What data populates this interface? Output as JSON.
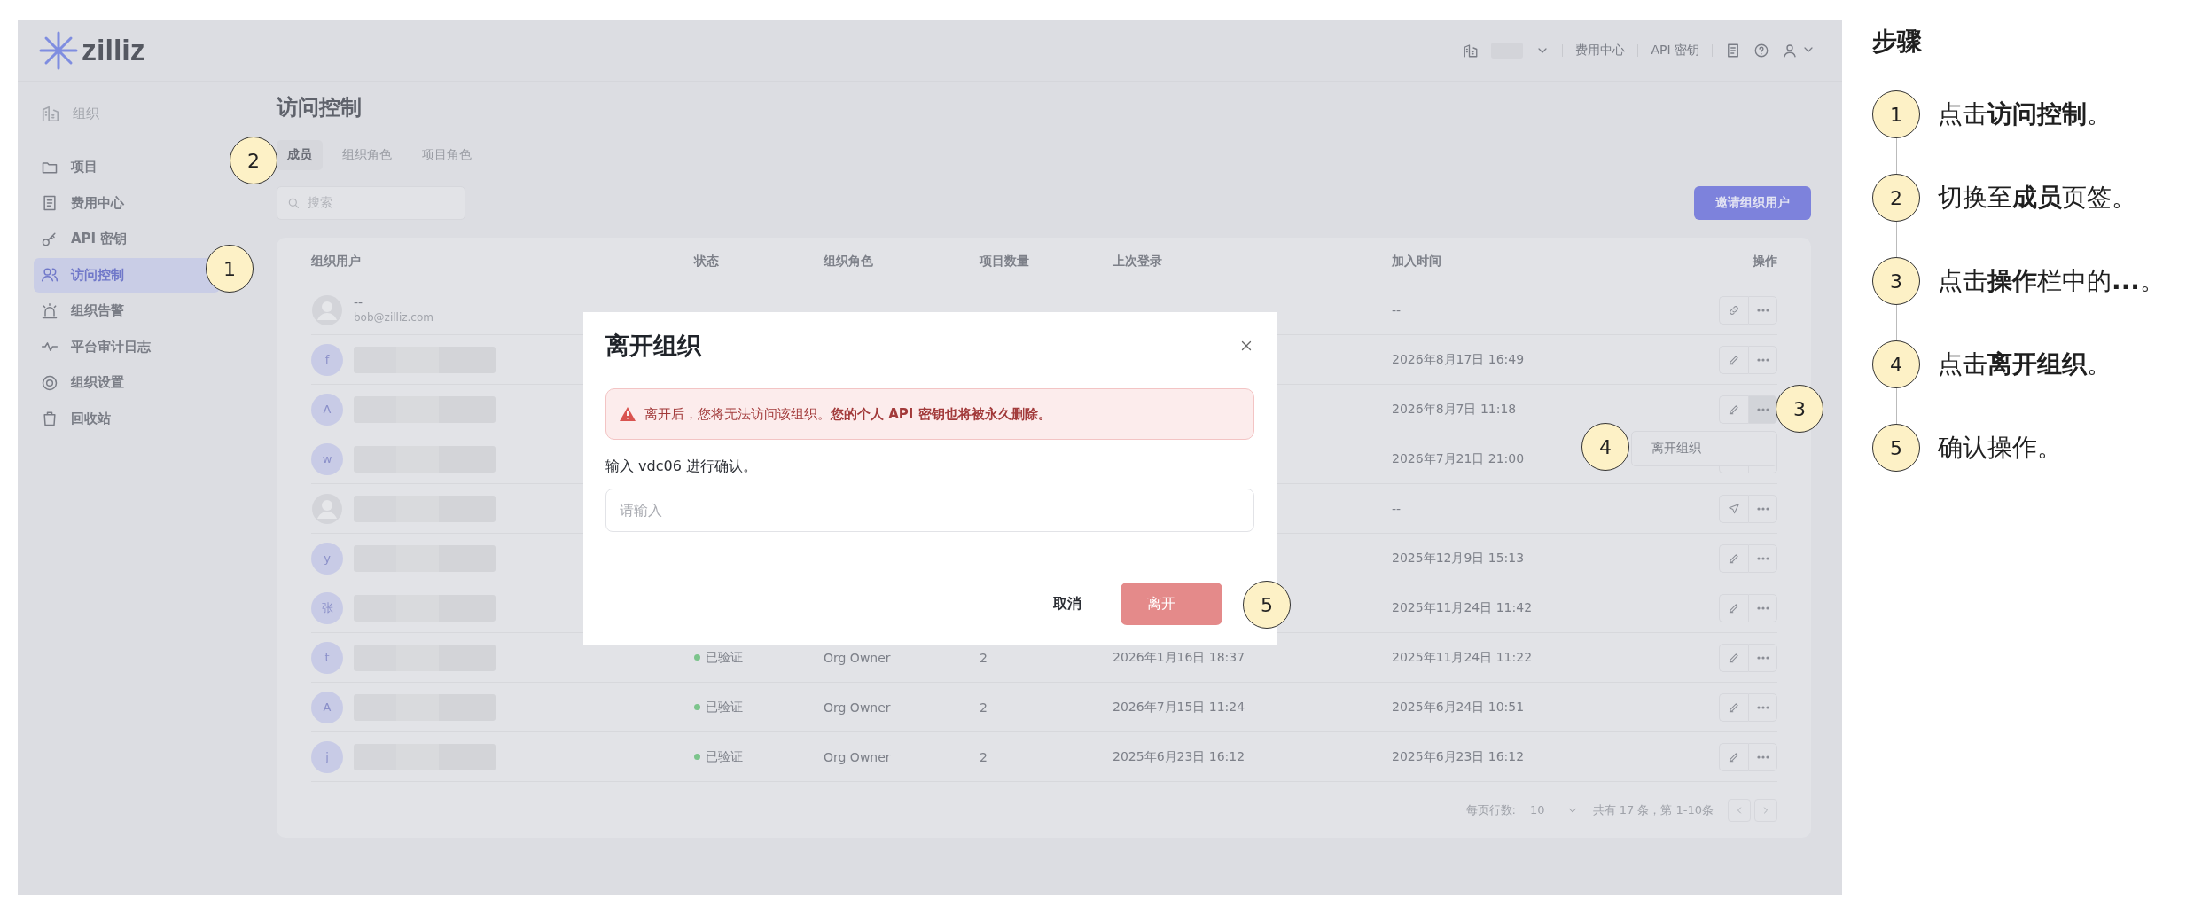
{
  "header": {
    "logo": "zilliz",
    "links": [
      "费用中心",
      "API 密钥"
    ]
  },
  "sidebar": {
    "org_label": "组织",
    "items": [
      {
        "label": "项目",
        "selected": false
      },
      {
        "label": "费用中心",
        "selected": false
      },
      {
        "label": "API 密钥",
        "selected": false
      },
      {
        "label": "访问控制",
        "selected": true
      },
      {
        "label": "组织告警",
        "selected": false
      },
      {
        "label": "平台审计日志",
        "selected": false
      },
      {
        "label": "组织设置",
        "selected": false
      },
      {
        "label": "回收站",
        "selected": false
      }
    ]
  },
  "page": {
    "title": "访问控制",
    "tabs": [
      {
        "label": "成员",
        "selected": true
      },
      {
        "label": "组织角色",
        "selected": false
      },
      {
        "label": "项目角色",
        "selected": false
      }
    ],
    "search": {
      "placeholder": "搜索"
    },
    "invite_button": "邀请组织用户"
  },
  "table": {
    "columns": [
      "组织用户",
      "状态",
      "组织角色",
      "项目数量",
      "上次登录",
      "加入时间",
      "操作"
    ],
    "rows": [
      {
        "kind": "invite",
        "name": "--",
        "email": "bob@zilliz.com",
        "joined": "--",
        "menu_open": false
      },
      {
        "kind": "member",
        "avatar": "f",
        "joined": "2026年8月17日 16:49",
        "menu_open": false
      },
      {
        "kind": "member",
        "avatar": "A",
        "joined": "2026年8月7日 11:18",
        "menu_open": true
      },
      {
        "kind": "member",
        "avatar": "w",
        "joined": "2026年7月21日 21:00",
        "menu_open": false
      },
      {
        "kind": "resend",
        "joined": "--",
        "menu_open": false
      },
      {
        "kind": "member",
        "avatar": "y",
        "joined": "2025年12月9日 15:13",
        "menu_open": false
      },
      {
        "kind": "member",
        "avatar": "张",
        "joined": "2025年11月24日 11:42",
        "menu_open": false
      },
      {
        "kind": "member",
        "avatar": "t",
        "status": "已验证",
        "role": "Org Owner",
        "projects": "2",
        "last_login": "2026年1月16日 18:37",
        "joined": "2025年11月24日 11:22",
        "menu_open": false
      },
      {
        "kind": "member",
        "avatar": "A",
        "status": "已验证",
        "role": "Org Owner",
        "projects": "2",
        "last_login": "2026年7月15日 11:24",
        "joined": "2025年6月24日 10:51",
        "menu_open": false
      },
      {
        "kind": "member",
        "avatar": "j",
        "status": "已验证",
        "role": "Org Owner",
        "projects": "2",
        "last_login": "2025年6月23日 16:12",
        "joined": "2025年6月23日 16:12",
        "menu_open": false
      }
    ]
  },
  "pagination": {
    "rows_label": "每页行数:",
    "rows_value": "10",
    "summary": "共有 17 条，第 1-10条"
  },
  "menu": {
    "items": [
      "离开组织"
    ]
  },
  "dialog": {
    "title": "离开组织",
    "alert": "离开后，您将无法访问该组织。**您的个人 API 密钥也将被永久删除。**",
    "prompt": "输入 vdc06 进行确认。",
    "input": {
      "placeholder": "请输入"
    },
    "cancel": "取消",
    "confirm": {
      "label": "离开",
      "disabled": true
    }
  },
  "callouts": [
    "1",
    "2",
    "3",
    "4",
    "5"
  ],
  "steps": {
    "title": "步骤",
    "items": [
      {
        "number": "1",
        "text": "点击**访问控制**。"
      },
      {
        "number": "2",
        "text": "切换至**成员**页签。"
      },
      {
        "number": "3",
        "text": "点击**操作**栏中的**...**。"
      },
      {
        "number": "4",
        "text": "点击**离开组织**。"
      },
      {
        "number": "5",
        "text": "确认操作。"
      }
    ]
  }
}
